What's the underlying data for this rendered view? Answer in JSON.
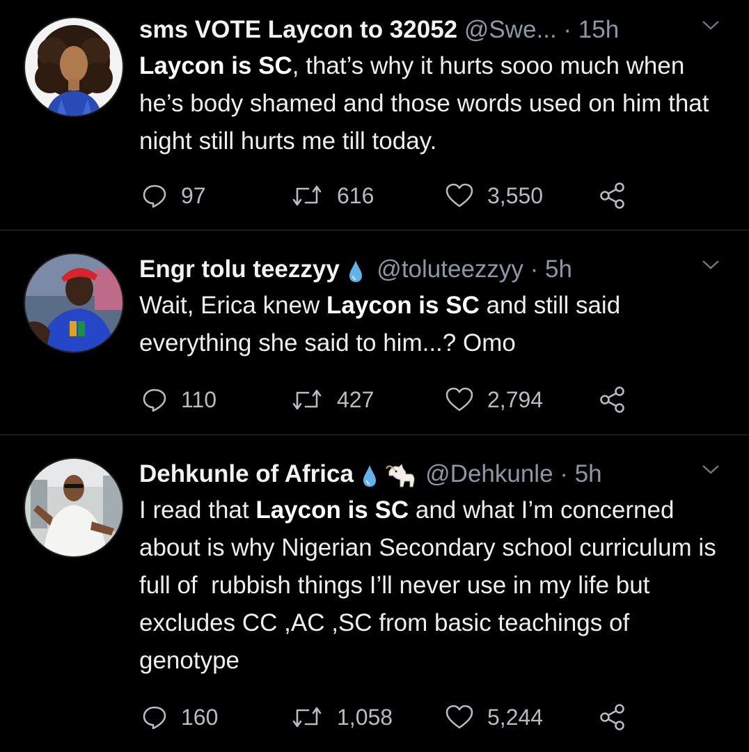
{
  "tweets": [
    {
      "name": "sms VOTE Laycon to 32052",
      "handle": "@Swe...",
      "dot": "·",
      "time": "15h",
      "text_parts": [
        {
          "bold": true,
          "t": "Laycon is SC"
        },
        {
          "bold": false,
          "t": ", that’s why it hurts sooo much when he’s body shamed and those words used on him that night still hurts me till today."
        }
      ],
      "replies": "97",
      "retweets": "616",
      "likes": "3,550"
    },
    {
      "name": "Engr tolu teezzyy",
      "handle": "@toluteezzyy",
      "dot": "·",
      "time": "5h",
      "text_parts": [
        {
          "bold": false,
          "t": "Wait, Erica knew "
        },
        {
          "bold": true,
          "t": "Laycon is SC"
        },
        {
          "bold": false,
          "t": " and still said everything she said to him...? Omo"
        }
      ],
      "replies": "110",
      "retweets": "427",
      "likes": "2,794"
    },
    {
      "name": "Dehkunle of Africa",
      "handle": "@Dehkunle",
      "dot": "·",
      "time": "5h",
      "text_parts": [
        {
          "bold": false,
          "t": "I read that "
        },
        {
          "bold": true,
          "t": "Laycon is SC"
        },
        {
          "bold": false,
          "t": " and what I’m concerned about is why Nigerian Secondary school curriculum is full of  rubbish things I’ll never use in my life but excludes CC ,AC ,SC from basic teachings of genotype"
        }
      ],
      "replies": "160",
      "retweets": "1,058",
      "likes": "5,244"
    }
  ],
  "icons": {
    "reply": "reply-icon",
    "retweet": "retweet-icon",
    "like": "heart-icon",
    "share": "share-icon",
    "menu": "chevron-down-icon",
    "badge_drop": "water-drop-icon",
    "badge_goat": "goat-emoji-icon"
  },
  "colors": {
    "background": "#000000",
    "muted": "#8b98a5",
    "drop": "#5fb3e8"
  }
}
